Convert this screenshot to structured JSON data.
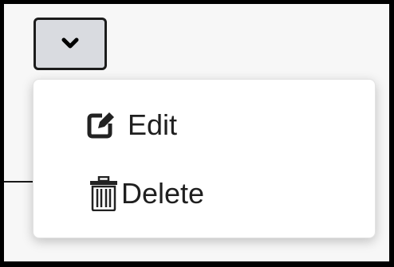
{
  "dropdown": {
    "toggle_icon": "chevron-down-icon",
    "items": [
      {
        "label": "Edit",
        "icon": "edit-icon"
      },
      {
        "label": "Delete",
        "icon": "trash-icon"
      }
    ]
  },
  "colors": {
    "button_background": "#d9dbe0",
    "menu_background": "#ffffff",
    "text": "#1f1f1f"
  }
}
